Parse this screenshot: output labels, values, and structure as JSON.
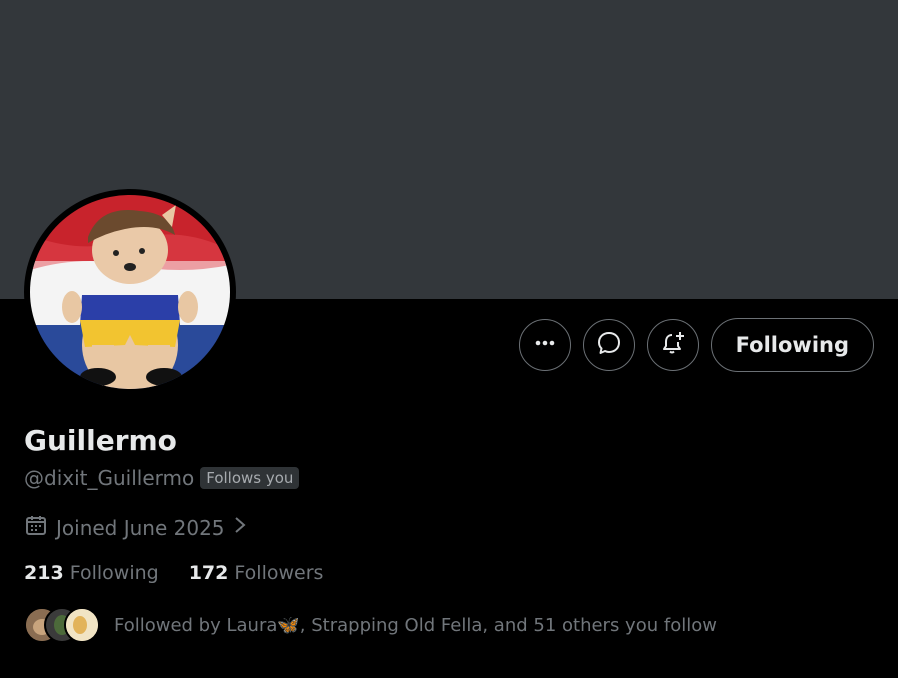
{
  "profile": {
    "display_name": "Guillermo",
    "handle": "@dixit_Guillermo",
    "follows_you_badge": "Follows you",
    "joined": "Joined June 2025",
    "following_count": "213",
    "following_label": "Following",
    "followers_count": "172",
    "followers_label": "Followers",
    "followed_by_text": "Followed by Laura🦋, Strapping Old Fella, and 51 others you follow"
  },
  "actions": {
    "more_icon": "ellipsis-icon",
    "message_icon": "message-icon",
    "notify_icon": "bell-plus-icon",
    "follow_button_label": "Following"
  },
  "colors": {
    "banner": "#33373b",
    "background": "#000000",
    "primary_text": "#e7e9ea",
    "secondary_text": "#71767b",
    "border": "#6b7075"
  }
}
